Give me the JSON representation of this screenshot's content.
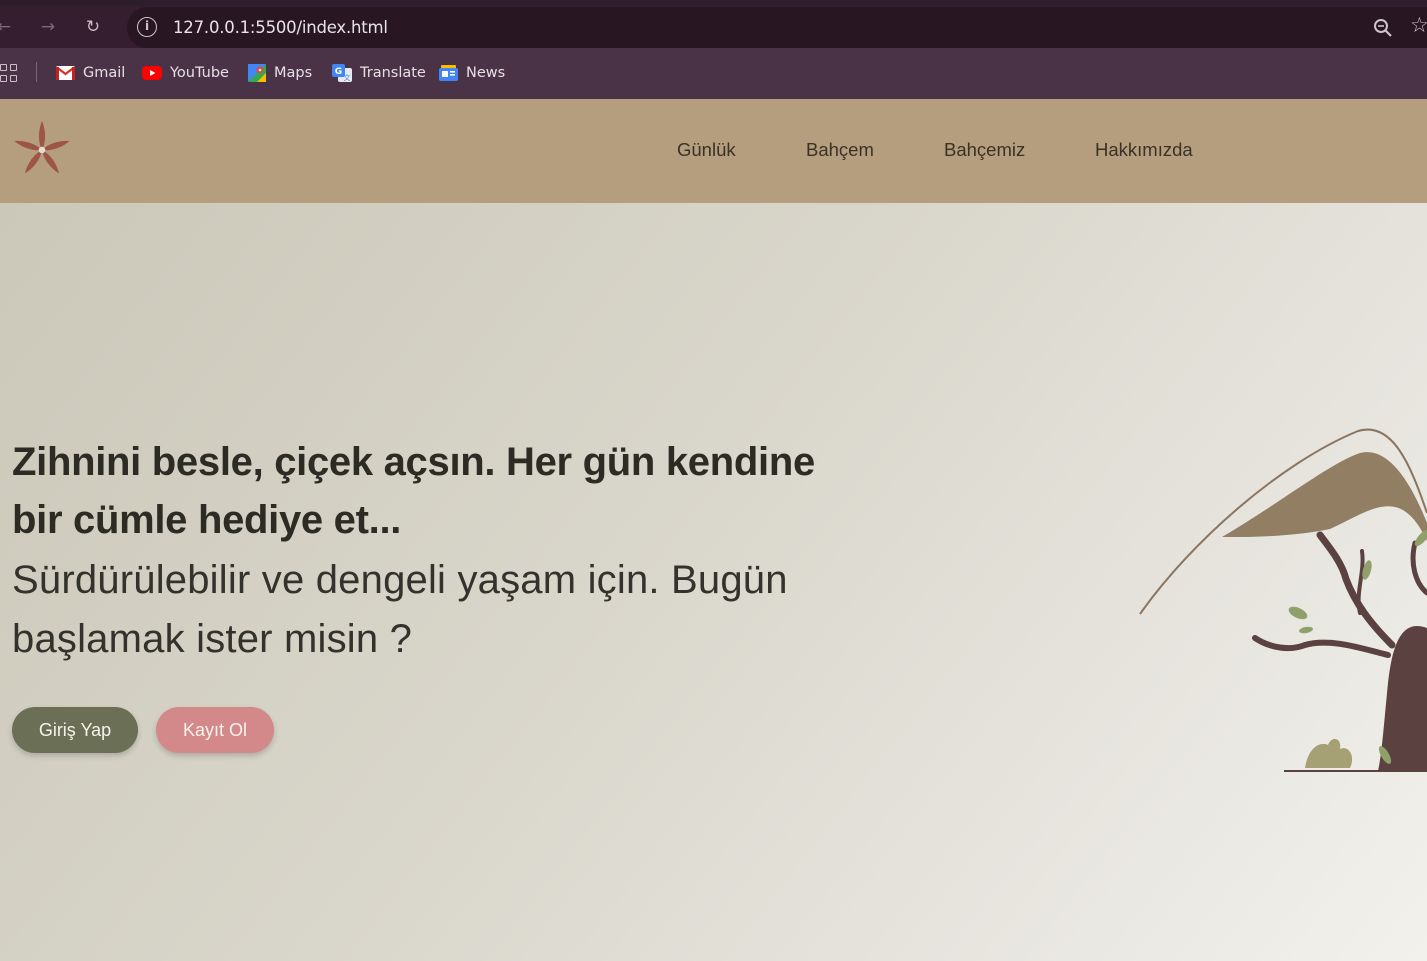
{
  "browser": {
    "url": "127.0.0.1:5500/index.html",
    "back_icon": "arrow-left-icon",
    "forward_icon": "arrow-right-icon",
    "reload_icon": "reload-icon",
    "bookmarks": [
      {
        "label": "Gmail",
        "icon": "gmail-icon"
      },
      {
        "label": "YouTube",
        "icon": "youtube-icon"
      },
      {
        "label": "Maps",
        "icon": "maps-icon"
      },
      {
        "label": "Translate",
        "icon": "translate-icon"
      },
      {
        "label": "News",
        "icon": "news-icon"
      }
    ]
  },
  "site": {
    "nav": [
      "Günlük",
      "Bahçem",
      "Bahçemiz",
      "Hakkımızda"
    ],
    "colors": {
      "header": "#b59e7d",
      "primary_button": "#6b6f55",
      "secondary_button": "#d3898a",
      "logo": "#9c5546"
    }
  },
  "hero": {
    "headline": "Zihnini besle, çiçek açsın. Her gün kendine bir cümle hediye et...",
    "subline": "Sürdürülebilir ve dengeli yaşam için. Bugün başlamak ister misin ?",
    "login_label": "Giriş Yap",
    "register_label": "Kayıt Ol"
  }
}
